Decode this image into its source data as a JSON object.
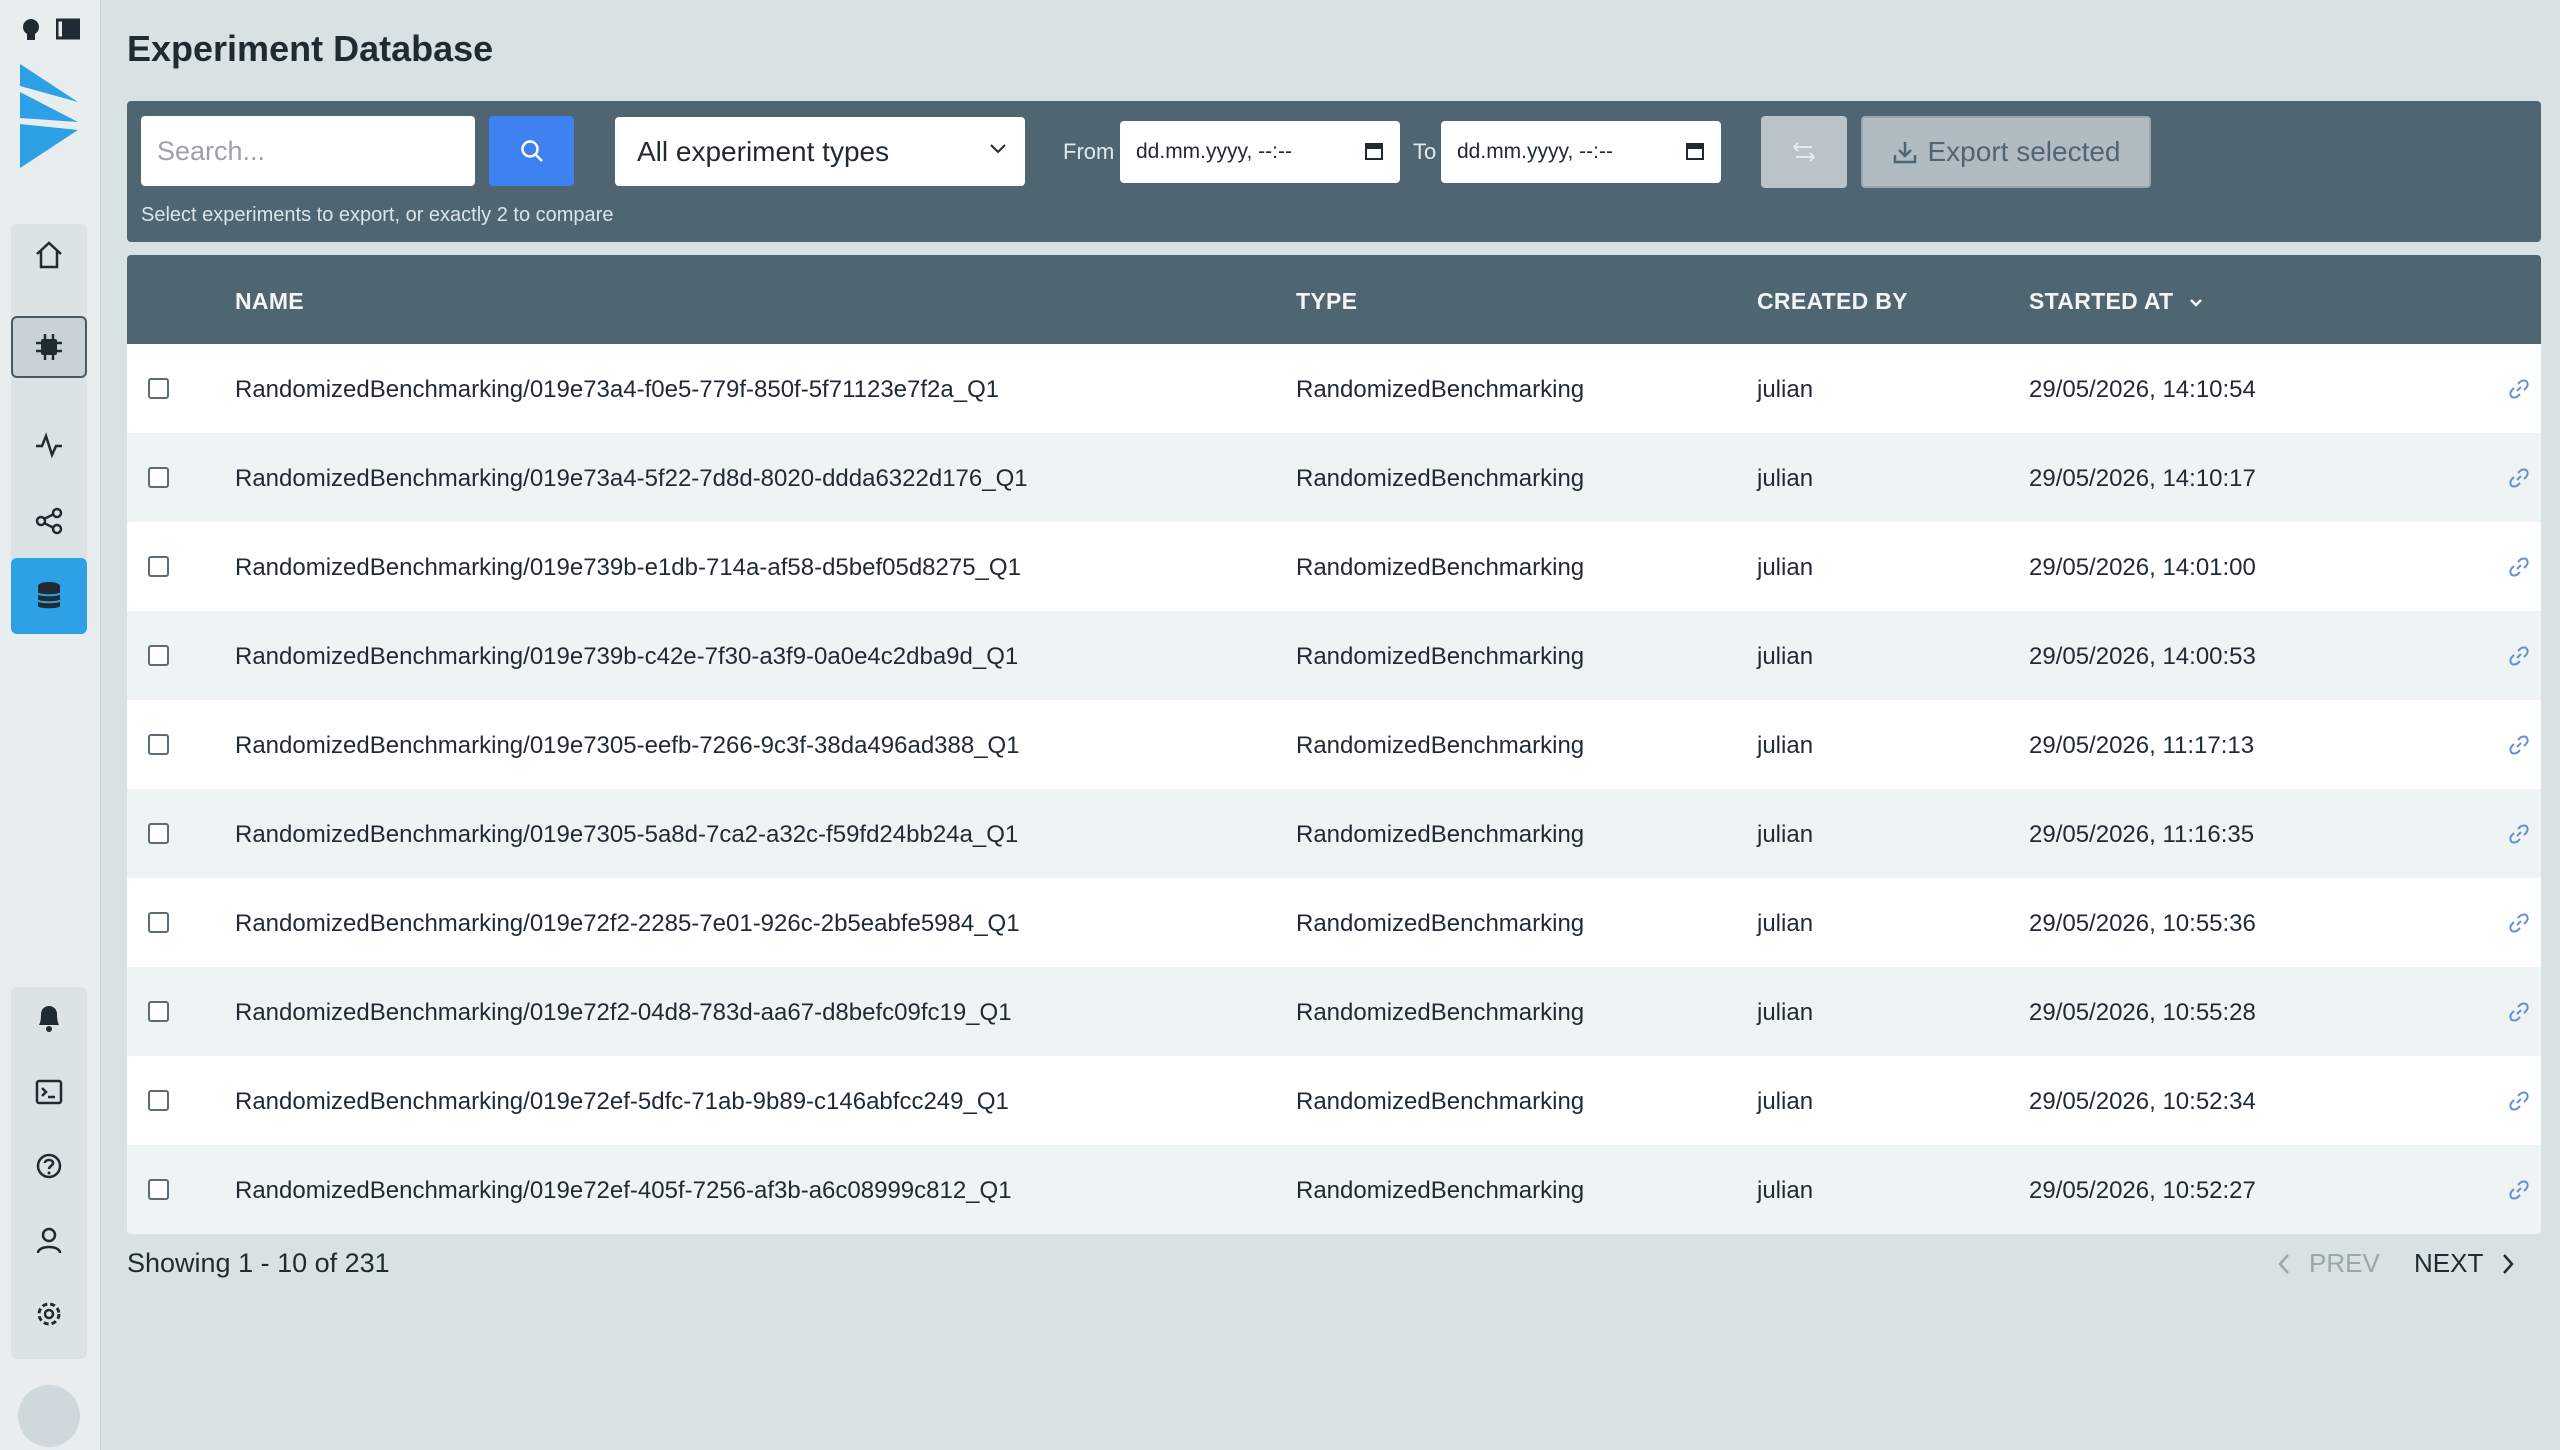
{
  "page": {
    "title": "Experiment Database"
  },
  "toolbar": {
    "search_placeholder": "Search...",
    "type_filter": "All experiment types",
    "from_label": "From",
    "to_label": "To",
    "from_value": "dd.mm.yyyy, --:--",
    "to_value": "dd.mm.yyyy, --:--",
    "export_label": "Export selected",
    "hint": "Select experiments to export, or exactly 2 to compare"
  },
  "table": {
    "columns": [
      "NAME",
      "TYPE",
      "CREATED BY",
      "STARTED AT"
    ],
    "rows": [
      {
        "name": "RandomizedBenchmarking/019e73a4-f0e5-779f-850f-5f71123e7f2a_Q1",
        "type": "RandomizedBenchmarking",
        "created_by": "julian",
        "started_at": "29/05/2026, 14:10:54"
      },
      {
        "name": "RandomizedBenchmarking/019e73a4-5f22-7d8d-8020-ddda6322d176_Q1",
        "type": "RandomizedBenchmarking",
        "created_by": "julian",
        "started_at": "29/05/2026, 14:10:17"
      },
      {
        "name": "RandomizedBenchmarking/019e739b-e1db-714a-af58-d5bef05d8275_Q1",
        "type": "RandomizedBenchmarking",
        "created_by": "julian",
        "started_at": "29/05/2026, 14:01:00"
      },
      {
        "name": "RandomizedBenchmarking/019e739b-c42e-7f30-a3f9-0a0e4c2dba9d_Q1",
        "type": "RandomizedBenchmarking",
        "created_by": "julian",
        "started_at": "29/05/2026, 14:00:53"
      },
      {
        "name": "RandomizedBenchmarking/019e7305-eefb-7266-9c3f-38da496ad388_Q1",
        "type": "RandomizedBenchmarking",
        "created_by": "julian",
        "started_at": "29/05/2026, 11:17:13"
      },
      {
        "name": "RandomizedBenchmarking/019e7305-5a8d-7ca2-a32c-f59fd24bb24a_Q1",
        "type": "RandomizedBenchmarking",
        "created_by": "julian",
        "started_at": "29/05/2026, 11:16:35"
      },
      {
        "name": "RandomizedBenchmarking/019e72f2-2285-7e01-926c-2b5eabfe5984_Q1",
        "type": "RandomizedBenchmarking",
        "created_by": "julian",
        "started_at": "29/05/2026, 10:55:36"
      },
      {
        "name": "RandomizedBenchmarking/019e72f2-04d8-783d-aa67-d8befc09fc19_Q1",
        "type": "RandomizedBenchmarking",
        "created_by": "julian",
        "started_at": "29/05/2026, 10:55:28"
      },
      {
        "name": "RandomizedBenchmarking/019e72ef-5dfc-71ab-9b89-c146abfcc249_Q1",
        "type": "RandomizedBenchmarking",
        "created_by": "julian",
        "started_at": "29/05/2026, 10:52:34"
      },
      {
        "name": "RandomizedBenchmarking/019e72ef-405f-7256-af3b-a6c08999c812_Q1",
        "type": "RandomizedBenchmarking",
        "created_by": "julian",
        "started_at": "29/05/2026, 10:52:27"
      }
    ]
  },
  "footer": {
    "showing": "Showing 1 - 10 of 231",
    "prev": "PREV",
    "next": "NEXT"
  },
  "colors": {
    "accent": "#3d82f0",
    "active_nav": "#2ea0e6",
    "header_bg": "#4f6672"
  }
}
